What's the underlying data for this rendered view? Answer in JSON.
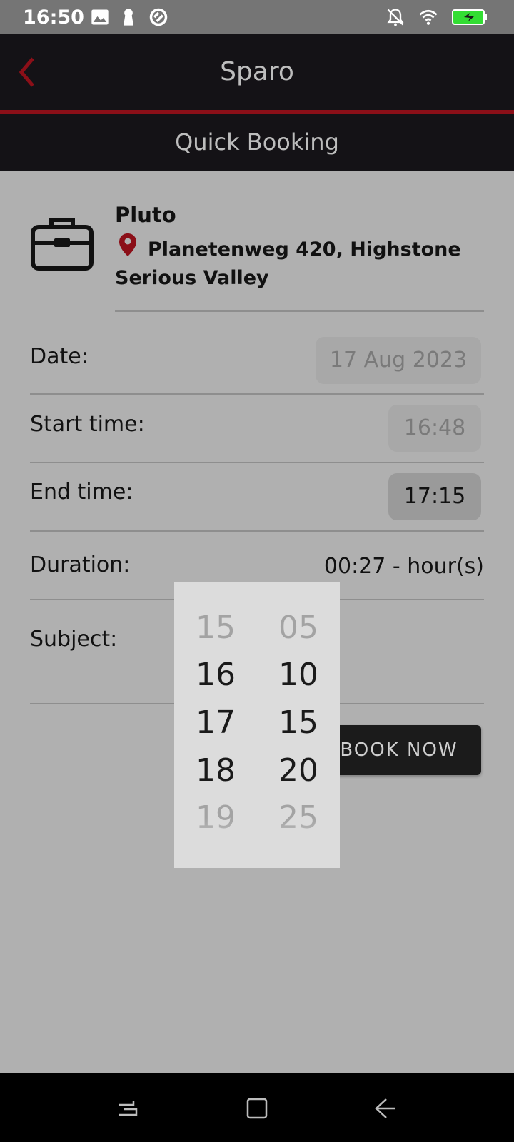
{
  "status_bar": {
    "time": "16:50",
    "left_icons": [
      "image-icon",
      "keyhole-icon",
      "sync-icon"
    ],
    "right_icons": [
      "notifications-off-icon",
      "wifi-icon",
      "battery-charging-icon"
    ],
    "battery_color": "#33dd33"
  },
  "app_bar": {
    "title": "Sparo",
    "back_icon": "chevron-left-icon",
    "accent_color": "#8b0f18"
  },
  "sub_header": {
    "title": "Quick Booking"
  },
  "location": {
    "icon": "briefcase-icon",
    "name": "Pluto",
    "address_line1": "Planetenweg 420, Highstone",
    "address_line2": "Serious Valley",
    "pin_icon": "location-pin-icon"
  },
  "form": {
    "date_label": "Date:",
    "date_value": "17 Aug 2023",
    "start_label": "Start time:",
    "start_value": "16:48",
    "end_label": "End time:",
    "end_value": "17:15",
    "duration_label": "Duration:",
    "duration_value": "00:27 - hour(s)",
    "subject_label": "Subject:"
  },
  "book_button": {
    "label": "BOOK NOW"
  },
  "time_picker": {
    "hours": [
      "15",
      "16",
      "17",
      "18",
      "19"
    ],
    "minutes": [
      "05",
      "10",
      "15",
      "20",
      "25"
    ],
    "selected_hour": "17",
    "selected_minute": "15"
  },
  "nav_bar": {
    "icons": [
      "recents-icon",
      "home-icon",
      "back-icon"
    ]
  }
}
